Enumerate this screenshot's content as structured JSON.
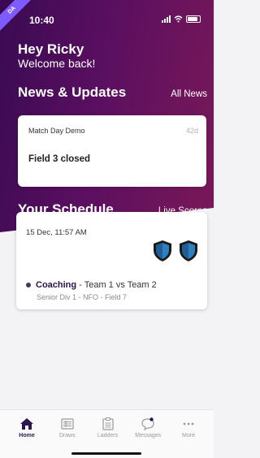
{
  "status_bar": {
    "time": "10:40",
    "badge": "DA"
  },
  "header": {
    "greeting_name": "Hey Ricky",
    "greeting_sub": "Welcome back!"
  },
  "news": {
    "title": "News & Updates",
    "link": "All News",
    "card": {
      "subtitle": "Match Day Demo",
      "age": "42d",
      "title": "Field 3 closed"
    }
  },
  "schedule": {
    "title": "Your Schedule",
    "link": "Live Scores",
    "card": {
      "datetime": "15 Dec, 11:57 AM",
      "type": "Coaching",
      "separator": " - ",
      "match": "Team 1 vs Team 2",
      "detail": "Senior Div 1 - NFO - Field 7"
    }
  },
  "tab_bar": {
    "items": [
      {
        "label": "Home",
        "icon": "home-icon",
        "active": true
      },
      {
        "label": "Draws",
        "icon": "draws-icon",
        "active": false
      },
      {
        "label": "Ladders",
        "icon": "ladders-icon",
        "active": false
      },
      {
        "label": "Messages",
        "icon": "messages-icon",
        "active": false
      },
      {
        "label": "More",
        "icon": "more-icon",
        "active": false
      }
    ]
  },
  "colors": {
    "hero_start": "#3a0a52",
    "hero_end": "#7a1858",
    "accent": "#2a1752",
    "shield_blue": "#2d7fbf"
  }
}
